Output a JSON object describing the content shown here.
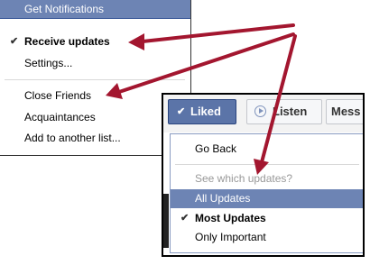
{
  "menu1": {
    "header": "Get Notifications",
    "items": [
      {
        "label": "Receive updates",
        "checked": true
      },
      {
        "label": "Settings...",
        "checked": false
      },
      {
        "label": "Close Friends",
        "checked": false
      },
      {
        "label": "Acquaintances",
        "checked": false
      },
      {
        "label": "Add to another list...",
        "checked": false
      }
    ]
  },
  "toolbar": {
    "liked_label": "Liked",
    "listen_label": "Listen",
    "mess_label": "Mess"
  },
  "dropdown": {
    "go_back": "Go Back",
    "section_label": "See which updates?",
    "options": [
      {
        "label": "All Updates",
        "highlighted": true,
        "checked": false
      },
      {
        "label": "Most Updates",
        "highlighted": false,
        "checked": true
      },
      {
        "label": "Only Important",
        "highlighted": false,
        "checked": false
      }
    ]
  },
  "colors": {
    "facebook_blue": "#6d84b4",
    "arrow": "#a3162f"
  },
  "glyphs": {
    "check": "✔"
  }
}
